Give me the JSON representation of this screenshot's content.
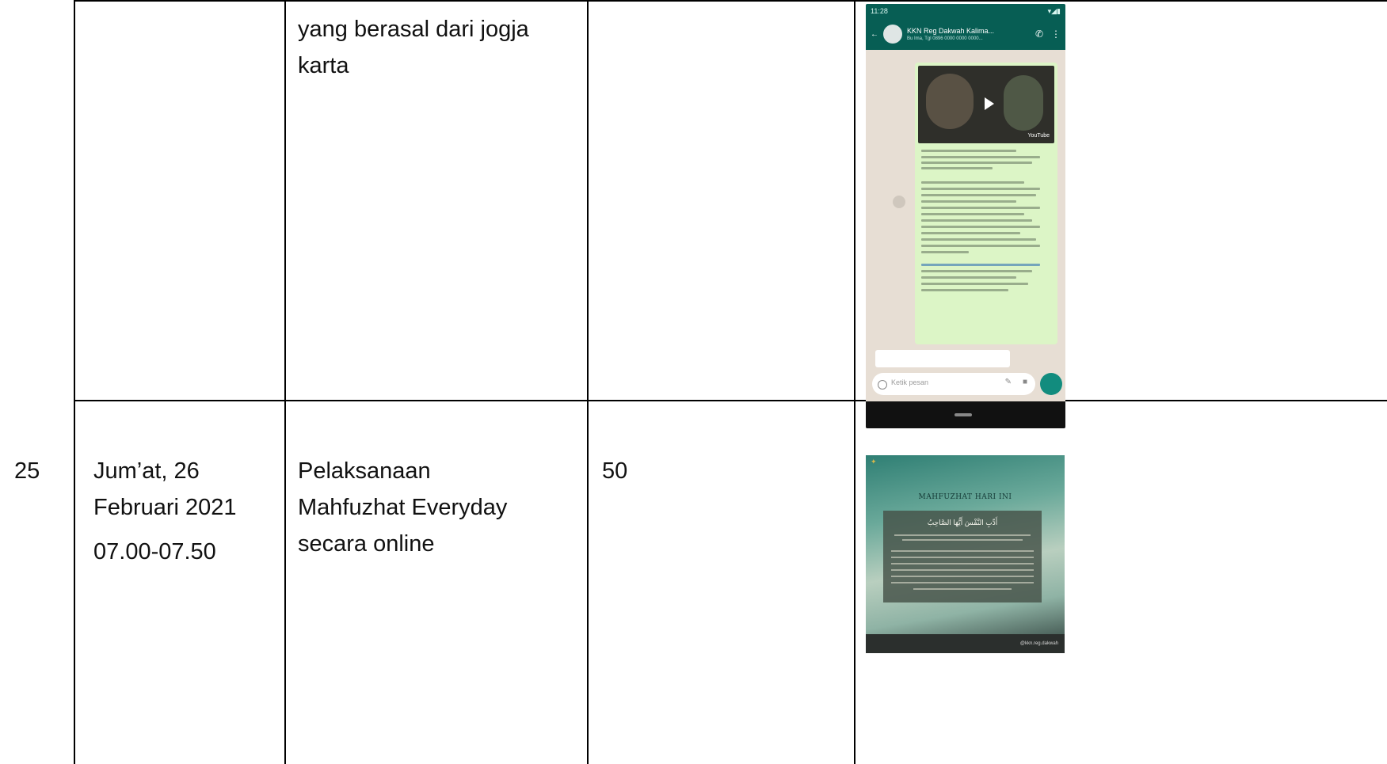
{
  "rows": [
    {
      "no": "",
      "date": [],
      "activity": [
        "yang berasal dari jogja",
        "karta"
      ],
      "participants": "",
      "evidence": {
        "type": "whatsapp-screenshot",
        "status_time": "11:28",
        "chat_title": "KKN Reg Dakwah Kalima...",
        "chat_subtitle": "Bu Ima, Tgl 0896 0000 0000 0000...",
        "video_label": "YouTube",
        "input_placeholder": "Ketik pesan"
      }
    },
    {
      "no": "25",
      "date": [
        "Jum’at, 26",
        "Februari 2021",
        "07.00-07.50"
      ],
      "activity": [
        "Pelaksanaan",
        "Mahfuzhat Everyday",
        "secara online"
      ],
      "participants": "50",
      "evidence": {
        "type": "poster",
        "poster_title": "MAHFUZHAT HARI INI",
        "arabic_text": "أَدِّبِ النَّفْسَ أَيُّهَا الصَّاحِبُ",
        "footer": "@kkn.reg.dakwah"
      }
    }
  ],
  "colors": {
    "border": "#000000",
    "whatsapp_green": "#075e54",
    "bubble": "#dcf5c6"
  }
}
